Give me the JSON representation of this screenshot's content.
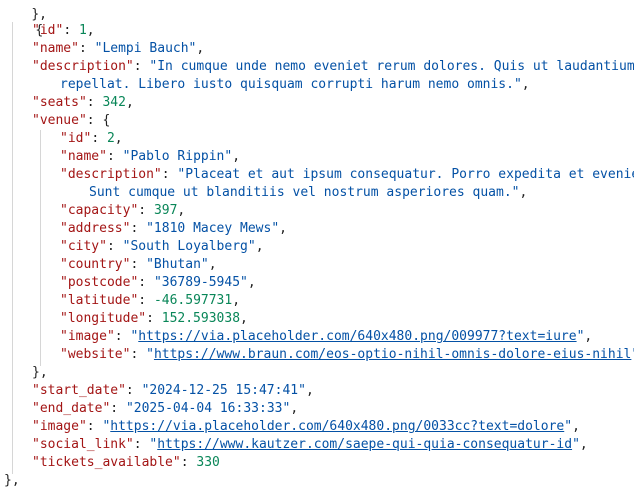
{
  "json_viewer": {
    "event": {
      "id": {
        "key": "\"id\"",
        "value": "1"
      },
      "name": {
        "key": "\"name\"",
        "value": "\"Lempi Bauch\""
      },
      "description": {
        "key": "\"description\"",
        "value_line1": "\"In cumque unde nemo eveniet rerum dolores. Quis ut laudantium tempor",
        "value_line2": "repellat. Libero iusto quisquam corrupti harum nemo omnis.\""
      },
      "seats": {
        "key": "\"seats\"",
        "value": "342"
      },
      "venue_key": "\"venue\"",
      "venue": {
        "id": {
          "key": "\"id\"",
          "value": "2"
        },
        "name": {
          "key": "\"name\"",
          "value": "\"Pablo Rippin\""
        },
        "description": {
          "key": "\"description\"",
          "value_line1": "\"Placeat et aut ipsum consequatur. Porro expedita et eveniet ipsu",
          "value_line2": "Sunt cumque ut blanditiis vel nostrum asperiores quam.\""
        },
        "capacity": {
          "key": "\"capacity\"",
          "value": "397"
        },
        "address": {
          "key": "\"address\"",
          "value": "\"1810 Macey Mews\""
        },
        "city": {
          "key": "\"city\"",
          "value": "\"South Loyalberg\""
        },
        "country": {
          "key": "\"country\"",
          "value": "\"Bhutan\""
        },
        "postcode": {
          "key": "\"postcode\"",
          "value": "\"36789-5945\""
        },
        "latitude": {
          "key": "\"latitude\"",
          "value": "-46.597731"
        },
        "longitude": {
          "key": "\"longitude\"",
          "value": "152.593038"
        },
        "image": {
          "key": "\"image\"",
          "url": "https://via.placeholder.com/640x480.png/009977?text=iure"
        },
        "website": {
          "key": "\"website\"",
          "url": "https://www.braun.com/eos-optio-nihil-omnis-dolore-eius-nihil"
        }
      },
      "start_date": {
        "key": "\"start_date\"",
        "value": "\"2024-12-25 15:47:41\""
      },
      "end_date": {
        "key": "\"end_date\"",
        "value": "\"2025-04-04 16:33:33\""
      },
      "image": {
        "key": "\"image\"",
        "url": "https://via.placeholder.com/640x480.png/0033cc?text=dolore"
      },
      "social_link": {
        "key": "\"social_link\"",
        "url": "https://www.kautzer.com/saepe-qui-quia-consequatur-id"
      },
      "tickets_available": {
        "key": "\"tickets_available\"",
        "value": "330"
      }
    },
    "punctuation": {
      "open_brace": "{",
      "close_brace": "}",
      "close_brace_comma": "},",
      "colon": ": ",
      "comma": ",",
      "quote": "\""
    }
  },
  "colors": {
    "key": "#a31515",
    "string": "#0451a5",
    "number": "#098658",
    "guide": "#d6d6d6"
  }
}
